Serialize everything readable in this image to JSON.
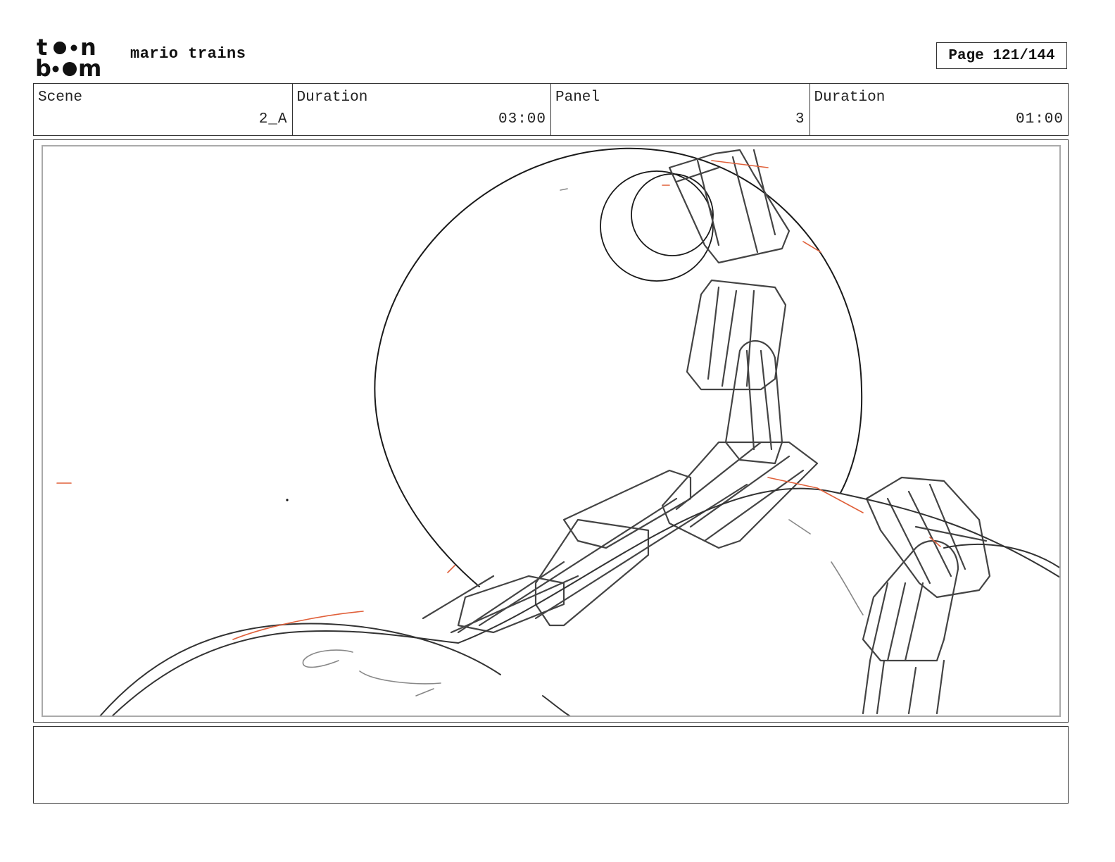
{
  "header": {
    "logo_text": "toonboom",
    "project_title": "mario trains",
    "page_label": "Page 121/144"
  },
  "info": {
    "scene_label": "Scene",
    "scene_value": "2_A",
    "scene_duration_label": "Duration",
    "scene_duration_value": "03:00",
    "panel_label": "Panel",
    "panel_value": "3",
    "panel_duration_label": "Duration",
    "panel_duration_value": "01:00"
  },
  "panel": {
    "sketch_subject": "sketch of chain links hanging over a large circle and a curved ground line",
    "sketch_colors": {
      "stroke_dark": "#1a1a1a",
      "stroke_gray": "#555555",
      "stroke_light": "#999999",
      "accent_red": "#e0603a"
    }
  },
  "notes": {
    "text": ""
  }
}
